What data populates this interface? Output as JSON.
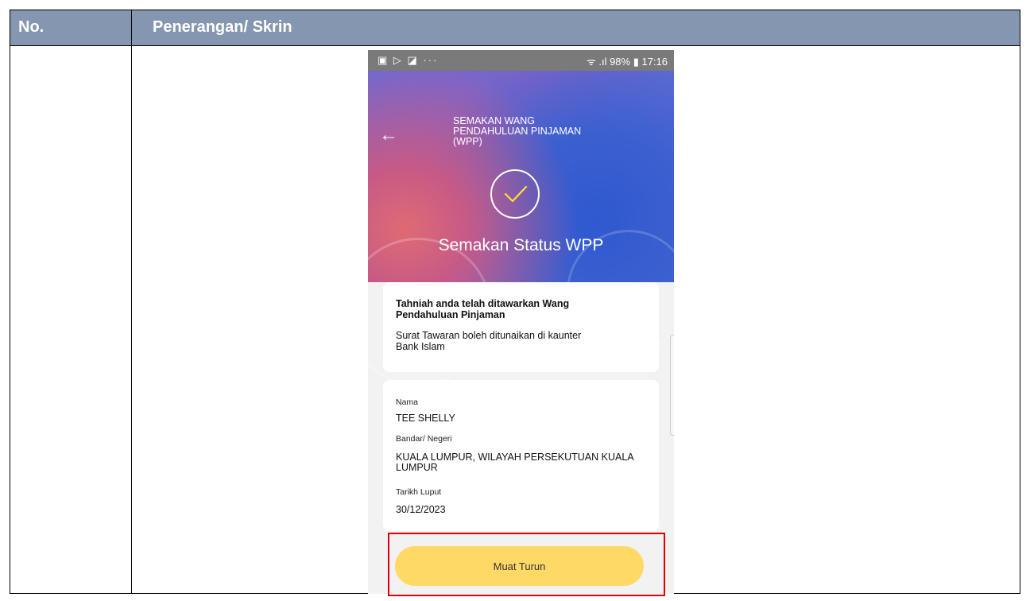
{
  "table": {
    "col1_header": "No.",
    "col2_header": "Penerangan/ Skrin"
  },
  "phone": {
    "status_left": "▣ ▷ ◪ ···",
    "status_right": "ᯤ .ıl 98% ▮ 17:16",
    "header": {
      "back_icon": "←",
      "title": "SEMAKAN WANG PENDAHULUAN PINJAMAN (WPP)",
      "status_title": "Semakan Status WPP"
    },
    "message_card": {
      "heading": "Tahniah anda telah ditawarkan Wang Pendahuluan Pinjaman",
      "body": "Surat Tawaran boleh ditunaikan di kaunter Bank Islam"
    },
    "details": {
      "nama_label": "Nama",
      "nama_value": "TEE SHELLY",
      "bandar_label": "Bandar/ Negeri",
      "bandar_value": "KUALA LUMPUR, WILAYAH PERSEKUTUAN KUALA LUMPUR",
      "tarikh_label": "Tarikh Luput",
      "tarikh_value": "30/12/2023"
    },
    "download_button": "Muat Turun"
  },
  "colors": {
    "table_header": "#8496b0",
    "button": "#ffd966",
    "highlight": "#e00000"
  }
}
